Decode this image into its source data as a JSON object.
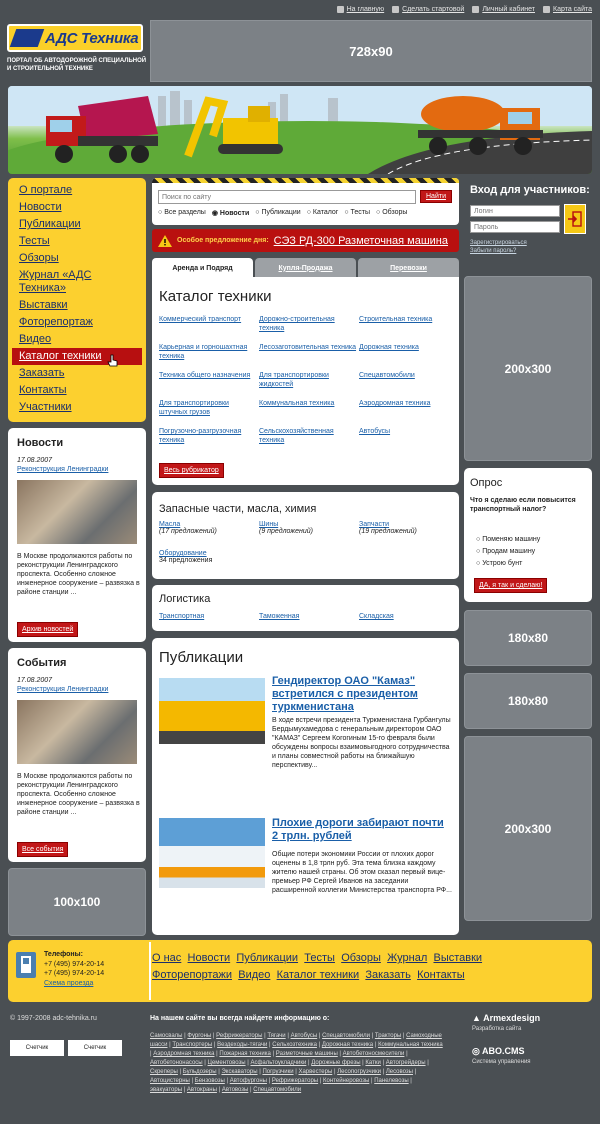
{
  "header": {
    "toplinks": [
      {
        "label": "На главную",
        "icon": "home-icon"
      },
      {
        "label": "Сделать стартовой",
        "icon": "star-icon"
      },
      {
        "label": "Личный кабинет",
        "icon": "user-icon"
      },
      {
        "label": "Карта сайта",
        "icon": "sitemap-icon"
      }
    ],
    "logo_text": "АДС Техника",
    "tagline": "ПОРТАЛ ОБ АВТОДОРОЖНОЙ СПЕЦИАЛЬНОЙ И СТРОИТЕЛЬНОЙ ТЕХНИКЕ",
    "top_ad": "728x90"
  },
  "menu": {
    "items": [
      "О портале",
      "Новости",
      "Публикации",
      "Тесты",
      "Обзоры",
      "Журнал «АДС Техника»",
      "Выставки",
      "Фоторепортаж",
      "Видео",
      "Каталог техники",
      "Заказать",
      "Контакты",
      "Участники"
    ],
    "active": "Каталог техники"
  },
  "search": {
    "placeholder": "Поиск по сайту",
    "button": "Найти",
    "options": [
      "Все разделы",
      "Новости",
      "Публикации",
      "Каталог",
      "Тесты",
      "Обзоры"
    ],
    "selected": "Новости"
  },
  "offer": {
    "label": "Особое предложение дня:",
    "text": "СЭЗ РД-300 Разметочная машина"
  },
  "tabs": [
    "Аренда и Подряд",
    "Купля-Продажа",
    "Перевозки"
  ],
  "catalog": {
    "title": "Каталог техники",
    "items": [
      "Коммерческий транспорт",
      "Дорожно-строительная техника",
      "Строительная техника",
      "Карьерная и горношахтная техника",
      "Лесозаготовительная техника",
      "Дорожная техника",
      "Техника общего назначения",
      "Для транспортировки жидкостей",
      "Спецавтомобили",
      "Для транспортировки штучных грузов",
      "Коммунальная техника",
      "Аэродромная техника",
      "Погрузочно-разгрузочная техника",
      "Сельскохозяйственная техника",
      "Автобусы"
    ],
    "button": "Весь рубрикатор"
  },
  "parts": {
    "title": "Запасные части, масла, химия",
    "items": [
      {
        "name": "Масла",
        "count": "(17 предложений)"
      },
      {
        "name": "Шины",
        "count": "(9 предложений)"
      },
      {
        "name": "Запчасти",
        "count": "(19 предложений)"
      }
    ],
    "extra_name": "Оборудование",
    "extra_count": "34 предложения"
  },
  "logistics": {
    "title": "Логистика",
    "items": [
      "Транспортная",
      "Таможенная",
      "Складская"
    ]
  },
  "publications": {
    "title": "Публикации",
    "items": [
      {
        "title": "Гендиректор ОАО \"Камаз\" встретился с президентом туркменистана",
        "text": "В ходе встречи президента Туркменистана Гурбангулы Бердымухамедова с генеральным директором ОАО \"КАМАЗ\" Сергеем Когогиным 15-го февраля были обсуждены вопросы взаимовыгодного сотрудничества и планы совместной работы на ближайшую перспективу..."
      },
      {
        "title": "Плохие дороги забирают почти 2 трлн. рублей",
        "text": "Общие потери экономики России от плохих дорог оценены в 1,8 трлн руб. Эта тема близка каждому жителю нашей страны. Об этом сказал первый вице-премьер РФ Сергей Иванов на заседании расширенной коллегии Министерства транспорта РФ..."
      }
    ]
  },
  "news": {
    "title": "Новости",
    "date": "17.08.2007",
    "link": "Реконструкция Ленинградки",
    "text": "В Москве продолжаются работы по реконструкции Ленинградского проспекта. Особенно сложное инженерное сооружение – развязка в районе станции ...",
    "button": "Архив новостей"
  },
  "events": {
    "title": "События",
    "date": "17.08.2007",
    "link": "Реконструкция Ленинградки",
    "text": "В Москве продолжаются работы по реконструкции Ленинградского проспекта. Особенно сложное инженерное сооружение – развязка в районе станции ...",
    "button": "Все события"
  },
  "ads": {
    "left_small": "100x100",
    "right_big1": "200x300",
    "right_small1": "180x80",
    "right_small2": "180x80",
    "right_big2": "200x300"
  },
  "login": {
    "title": "Вход для участников:",
    "login_placeholder": "Логин",
    "password_placeholder": "Пароль",
    "register": "Зарегистрироваться",
    "forgot": "Забыли пароль?"
  },
  "poll": {
    "title": "Опрос",
    "question": "Что я сделаю если повысится транспортный налог?",
    "options": [
      "Поменяю машину",
      "Продам машину",
      "Устрою бунт"
    ],
    "button": "ДА, я так и сделаю!"
  },
  "footer": {
    "phones_label": "Телефоны:",
    "phones": [
      "+7 (495) 974-20-14",
      "+7 (495) 974-20-14"
    ],
    "map": "Схема проезда",
    "menu_row1": [
      "О нас",
      "Новости",
      "Публикации",
      "Тесты",
      "Обзоры",
      "Журнал",
      "Выставки"
    ],
    "menu_row2": [
      "Фоторепортажи",
      "Видео",
      "Каталог техники",
      "Заказать",
      "Контакты"
    ],
    "copyright": "© 1997-2008 adc-tehnika.ru",
    "counter": "Счетчик",
    "info_title": "На нашем сайте вы всегда найдете информацию о:",
    "tags": [
      "Самосвалы",
      "Фургоны",
      "Рефрижераторы",
      "Тягачи",
      "Автобусы",
      "Спецавтомобили",
      "Тракторы",
      "Самоходные шасси",
      "Транспортеры",
      "Вездеходы-тягачи",
      "Сельхозтехника",
      "Дорожная техника",
      "Коммунальная техника",
      "Аэродромная техника",
      "Пожарная техника",
      "Разметочные машины",
      "Автобетоносмесители",
      "Автобетононасосы",
      "Цементовозы",
      "Асфальтоукладчики",
      "Дорожные фрезы",
      "Катки",
      "Автогрейдеры",
      "Скреперы",
      "Бульдозеры",
      "Экскаваторы",
      "Погрузчики",
      "Харвестеры",
      "Лесопогрузчики",
      "Лесовозы",
      "Автоцистерны",
      "Бензовозы",
      "Автофургоны",
      "Рефрижераторы",
      "Контейнеровозы",
      "Панелевозы",
      "эвакуаторы",
      "Автокраны",
      "Автовозы",
      "Спецавтомобили"
    ],
    "dev1": "Armexdesign",
    "dev1_sub": "Разработка сайта",
    "dev2": "ABO.CMS",
    "dev2_sub": "Система управления"
  }
}
